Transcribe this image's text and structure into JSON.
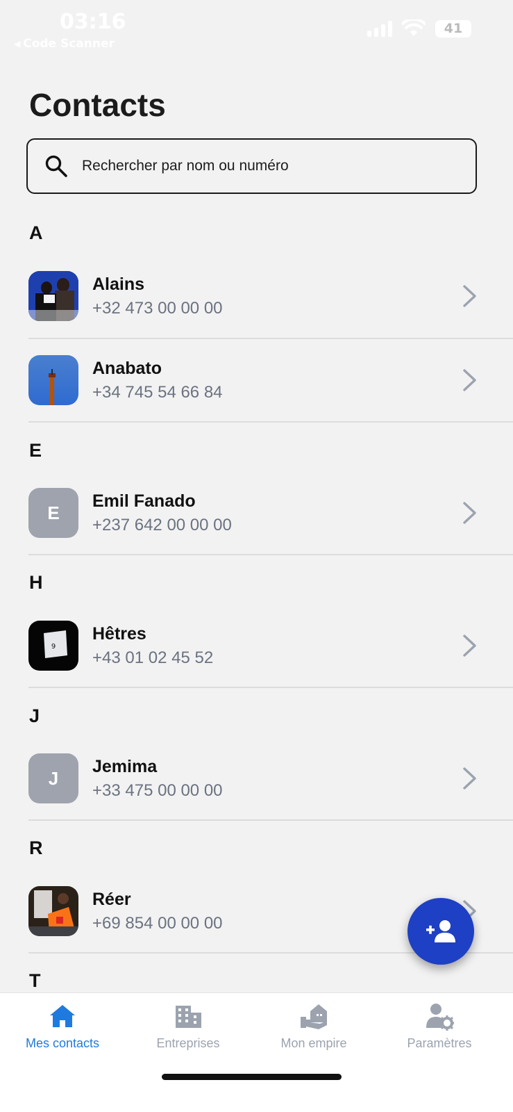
{
  "status_bar": {
    "time": "03:16",
    "back_app": "Code Scanner",
    "battery": "41"
  },
  "header": {
    "title": "Contacts"
  },
  "search": {
    "placeholder": "Rechercher par nom ou numéro"
  },
  "sections": [
    {
      "letter": "A",
      "contacts": [
        {
          "name": "Alains",
          "phone": "+32 473 00 00 00"
        },
        {
          "name": "Anabato",
          "phone": "+34 745 54 66 84"
        }
      ]
    },
    {
      "letter": "E",
      "contacts": [
        {
          "name": "Emil Fanado",
          "phone": "+237 642 00 00 00",
          "initial": "E"
        }
      ]
    },
    {
      "letter": "H",
      "contacts": [
        {
          "name": "Hêtres",
          "phone": "+43 01 02 45 52"
        }
      ]
    },
    {
      "letter": "J",
      "contacts": [
        {
          "name": "Jemima",
          "phone": "+33 475 00 00 00",
          "initial": "J"
        }
      ]
    },
    {
      "letter": "R",
      "contacts": [
        {
          "name": "Réer",
          "phone": "+69 854 00 00 00"
        }
      ]
    },
    {
      "letter": "T",
      "contacts": []
    }
  ],
  "tabs": [
    {
      "label": "Mes contacts",
      "icon": "home-icon",
      "active": true
    },
    {
      "label": "Entreprises",
      "icon": "building-icon",
      "active": false
    },
    {
      "label": "Mon empire",
      "icon": "empire-icon",
      "active": false
    },
    {
      "label": "Paramètres",
      "icon": "user-settings-icon",
      "active": false
    }
  ],
  "colors": {
    "accent": "#1f7ae0",
    "fab": "#1e40c4",
    "initial_avatar": "#9ea3ad",
    "inactive_tab": "#9ca3af"
  }
}
